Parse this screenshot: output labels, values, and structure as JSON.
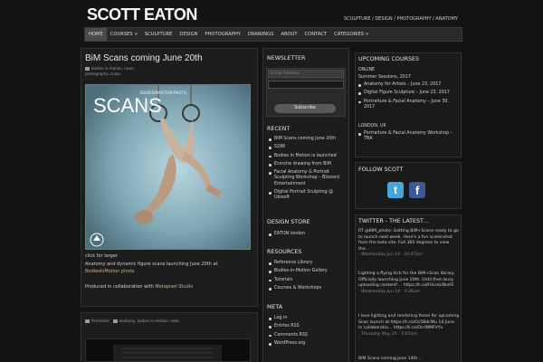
{
  "header": {
    "logo": "SCOTT EATON",
    "tagline": "SCULPTURE / DESIGN / PHOTOGRAPHY / ANATOMY"
  },
  "nav": {
    "items": [
      {
        "label": "HOME",
        "active": true,
        "caret": false
      },
      {
        "label": "COURSES",
        "active": false,
        "caret": true
      },
      {
        "label": "SCULPTURE",
        "active": false,
        "caret": false
      },
      {
        "label": "DESIGN",
        "active": false,
        "caret": false
      },
      {
        "label": "PHOTOGRAPHY",
        "active": false,
        "caret": false
      },
      {
        "label": "DRAWINGS",
        "active": false,
        "caret": false
      },
      {
        "label": "ABOUT",
        "active": false,
        "caret": false
      },
      {
        "label": "CONTACT",
        "active": false,
        "caret": false
      },
      {
        "label": "CATEGORIES",
        "active": false,
        "caret": true
      }
    ]
  },
  "post": {
    "title": "BiM Scans coming June 20th",
    "meta": "bodies-in-motion, news, photography, scans",
    "image": {
      "watermark": "BODIESINMOTION PHOTO",
      "title": "SCANS"
    },
    "click_for_larger": "click for larger",
    "line1": "Anatomy and dynamic figure scans launching June 20th at",
    "line1_link": "BodiesInMotion photo.",
    "line2": "Produced in collaboration with",
    "line2_link": "Metapixel Studio"
  },
  "post2": {
    "meta_left": "Permalink",
    "meta_right": "anatomy, bodies-in-motion, news"
  },
  "newsletter": {
    "title": "NEWSLETTER",
    "placeholder": "Email Address",
    "button": "Subscribe"
  },
  "recent": {
    "title": "RECENT",
    "items": [
      "BiM Scans coming June 20th",
      "S286",
      "Bodies in Motion is launched",
      "Ecorche drawing from BiM",
      "Facial Anatomy & Portrait Sculpting Workshop – Blizzard Entertainment",
      "Digital Portrait Sculpting @ Ubisoft"
    ]
  },
  "design_store": {
    "title": "DESIGN STORE",
    "items": [
      "EATON london"
    ]
  },
  "resources": {
    "title": "RESOURCES",
    "items": [
      "Reference Library",
      "Bodies-in-Motion Gallery",
      "Tutorials",
      "Courses & Workshops"
    ]
  },
  "meta": {
    "title": "META",
    "items": [
      "Log in",
      "Entries RSS",
      "Comments RSS",
      "WordPress.org"
    ]
  },
  "upcoming": {
    "title": "UPCOMING COURSES",
    "online_label": "ONLINE",
    "online_sub": "Summer Sessions, 2017",
    "online_items": [
      "Anatomy for Artists – June 23, 2017",
      "Digital Figure Sculpture – June 23, 2017",
      "Portraiture & Facial Anatomy – June 30, 2017"
    ],
    "london_label": "LONDON, UK",
    "london_items": [
      "Portraiture & Facial Anatomy Workshop – TBA"
    ]
  },
  "follow": {
    "title": "FOLLOW SCOTT",
    "twitter_glyph": "t",
    "facebook_glyph": "f"
  },
  "twitter": {
    "title": "TWITTER - THE LATEST…",
    "tweets": [
      {
        "text": "RT @BiM_photo: Getting BiM+Scans ready to go to launch next week. Here's a fun screenshot from the beta site. Full 360 degrees to view the…",
        "time": "- Wednesday Jun 14 - 10:47pm"
      },
      {
        "text": "Lighting a flying kick for the BiM+Scan library. Officially launching June 20th. Until then busy uploading content!… https://t.co/FHLmL9bsFE",
        "time": "- Wednesday Jun 14 - 5:26am"
      },
      {
        "text": "I love lighting and rendering these for upcoming Scan launch at https://t.co/Oc5BdcWu 14 June. In collaboratio… https://t.co/OcrWMFVYx",
        "time": "- Thursday May 25 - 5:07am"
      },
      {
        "text": "BiM Scans coming June 14th…",
        "time": ""
      }
    ]
  }
}
